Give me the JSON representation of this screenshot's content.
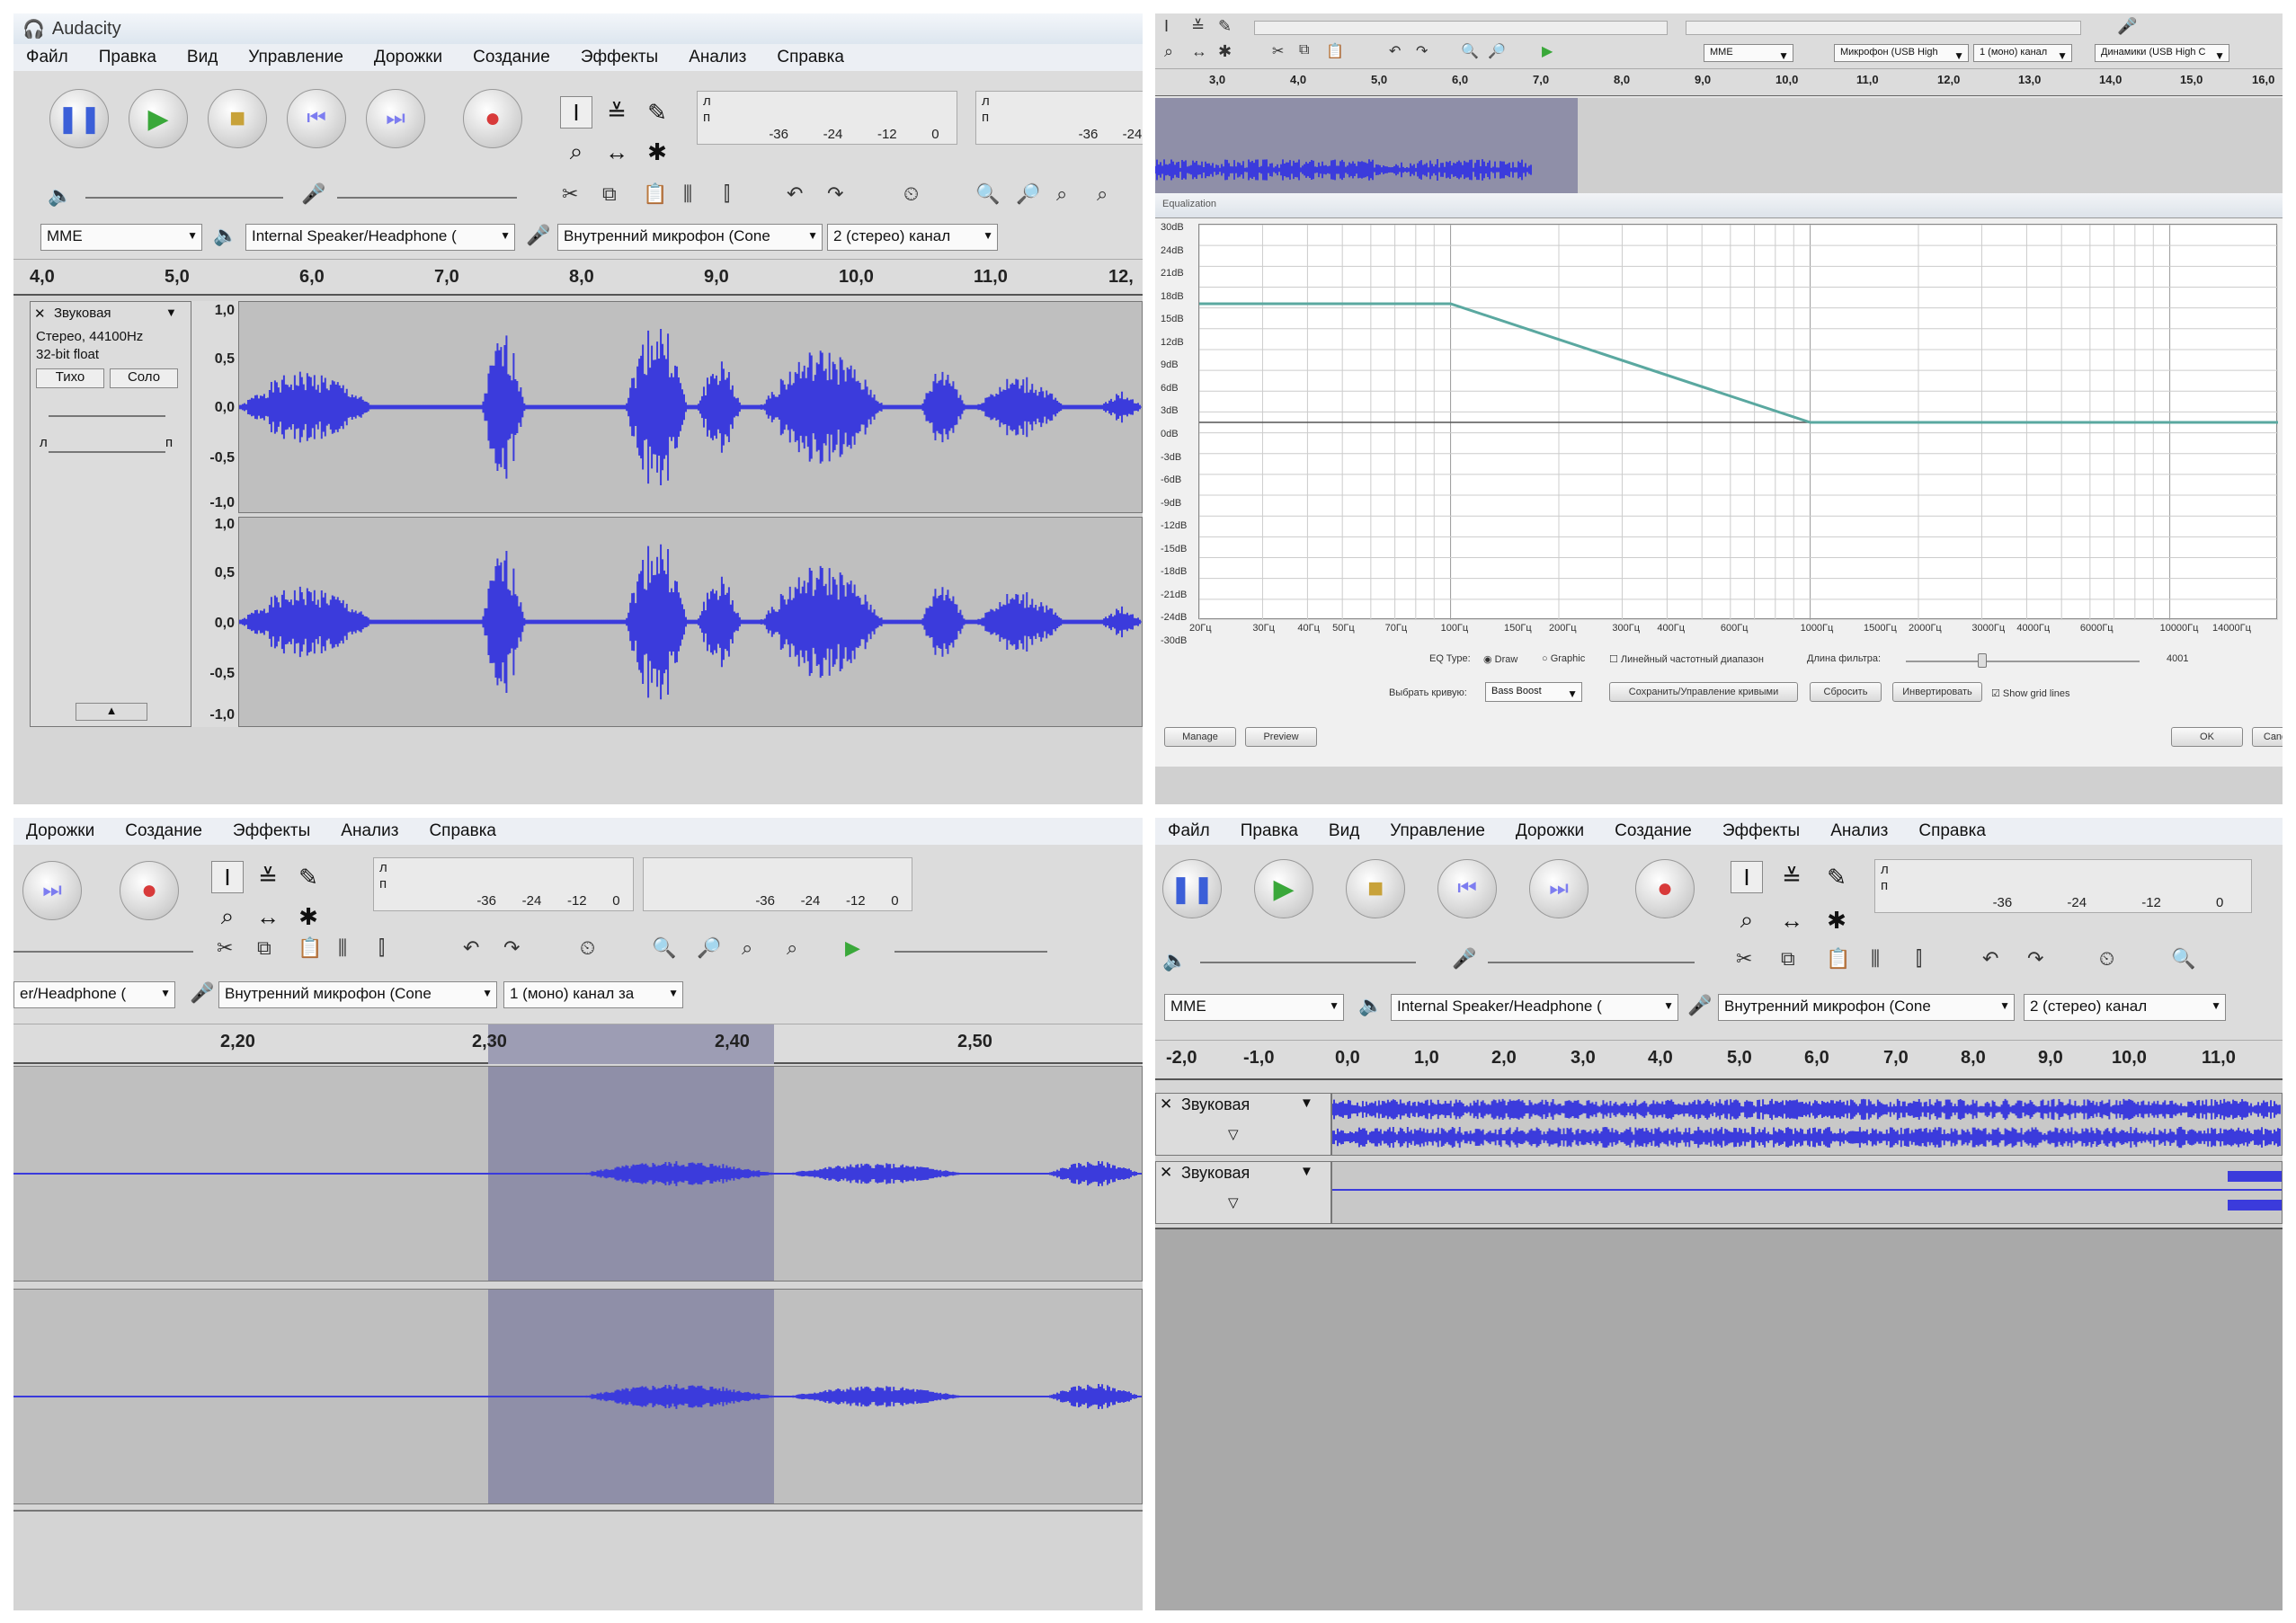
{
  "p1": {
    "title": "Audacity",
    "menu": [
      "Файл",
      "Правка",
      "Вид",
      "Управление",
      "Дорожки",
      "Создание",
      "Эффекты",
      "Анализ",
      "Справка"
    ],
    "meter_play": {
      "l": "л",
      "r": "п",
      "scale": [
        "-36",
        "-24",
        "-12",
        "0"
      ]
    },
    "meter_rec": {
      "l": "л",
      "r": "п",
      "scale": [
        "-36",
        "-24"
      ]
    },
    "host": "MME",
    "output": "Internal Speaker/Headphone (",
    "input": "Внутренний микрофон (Cone",
    "channels": "2 (стерео) канал",
    "ruler": [
      "4,0",
      "5,0",
      "6,0",
      "7,0",
      "8,0",
      "9,0",
      "10,0",
      "11,0",
      "12,"
    ],
    "track": {
      "name": "Звуковая",
      "info1": "Стерео, 44100Hz",
      "info2": "32-bit float",
      "mute": "Тихо",
      "solo": "Соло",
      "pan_l": "л",
      "pan_r": "п"
    },
    "vscale": [
      "1,0",
      "0,5",
      "0,0",
      "-0,5",
      "-1,0"
    ]
  },
  "p2": {
    "ruler": [
      "3,0",
      "4,0",
      "5,0",
      "6,0",
      "7,0",
      "8,0",
      "9,0",
      "10,0",
      "11,0",
      "12,0",
      "13,0",
      "14,0",
      "15,0",
      "16,0"
    ],
    "dlg_title": "Equalization",
    "yticks": [
      "30dB",
      "24dB",
      "21dB",
      "18dB",
      "15dB",
      "12dB",
      "9dB",
      "6dB",
      "3dB",
      "0dB",
      "-3dB",
      "-6dB",
      "-9dB",
      "-12dB",
      "-15dB",
      "-18dB",
      "-21dB",
      "-24dB",
      "-30dB"
    ],
    "xticks": [
      "20Гц",
      "30Гц",
      "40Гц",
      "50Гц",
      "70Гц",
      "100Гц",
      "150Гц",
      "200Гц",
      "300Гц",
      "400Гц",
      "600Гц",
      "1000Гц",
      "1500Гц",
      "2000Гц",
      "3000Гц",
      "4000Гц",
      "6000Гц",
      "10000Гц",
      "14000Гц"
    ],
    "eq_type": "EQ Type:",
    "draw": "Draw",
    "graphic": "Graphic",
    "linear": "Линейный частотный диапазон",
    "filter_len": "Длина фильтра:",
    "filter_val": "4001",
    "choose_curve": "Выбрать кривую:",
    "curve_val": "Bass Boost",
    "save_btn": "Сохранить/Управление кривыми",
    "reset_btn": "Сбросить",
    "invert_btn": "Инвертировать",
    "grid_lines": "Show grid lines",
    "manage": "Manage",
    "preview": "Preview",
    "ok": "OK",
    "cancel": "Cancel",
    "host": "MME",
    "input": "Микрофон (USB High",
    "channels": "1 (моно) канал",
    "output": "Динамики (USB High C"
  },
  "p3": {
    "menu": [
      "Дорожки",
      "Создание",
      "Эффекты",
      "Анализ",
      "Справка"
    ],
    "meter": {
      "l": "л",
      "r": "п",
      "scale": [
        "-36",
        "-24",
        "-12",
        "0"
      ]
    },
    "meter2": {
      "scale": [
        "-36",
        "-24",
        "-12",
        "0"
      ]
    },
    "output": "er/Headphone (",
    "input": "Внутренний микрофон (Cone",
    "channels": "1 (моно) канал за",
    "ruler": [
      "2,20",
      "2,30",
      "2,40",
      "2,50"
    ]
  },
  "p4": {
    "menu": [
      "Файл",
      "Правка",
      "Вид",
      "Управление",
      "Дорожки",
      "Создание",
      "Эффекты",
      "Анализ",
      "Справка"
    ],
    "meter": {
      "l": "л",
      "r": "п",
      "scale": [
        "-36",
        "-24",
        "-12",
        "0"
      ]
    },
    "host": "MME",
    "output": "Internal Speaker/Headphone (",
    "input": "Внутренний микрофон (Cone",
    "channels": "2 (стерео) канал",
    "ruler": [
      "-2,0",
      "-1,0",
      "0,0",
      "1,0",
      "2,0",
      "3,0",
      "4,0",
      "5,0",
      "6,0",
      "7,0",
      "8,0",
      "9,0",
      "10,0",
      "11,0"
    ],
    "track1": "Звуковая",
    "track2": "Звуковая"
  },
  "colors": {
    "wave": "#3b3bdc",
    "eqline": "#5aa8a0",
    "bg": "#d6d6d6",
    "selection": "#8f8fa8"
  }
}
